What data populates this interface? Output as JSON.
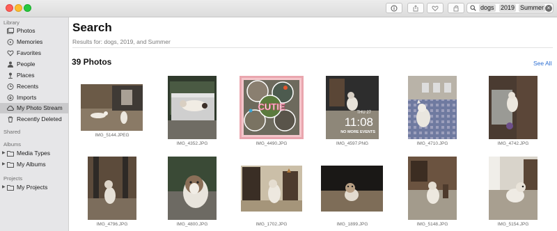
{
  "window": {
    "toolbar_icons": [
      "info-icon",
      "share-icon",
      "heart-icon",
      "rotate-icon",
      "search-icon"
    ],
    "search": {
      "tokens": [
        "dogs",
        "2019",
        "Summer"
      ],
      "clear_icon": "clear-icon"
    }
  },
  "sidebar": {
    "sections": {
      "library": "Library",
      "shared": "Shared",
      "albums": "Albums",
      "projects": "Projects"
    },
    "library_items": [
      {
        "label": "Photos",
        "icon": "photos-icon"
      },
      {
        "label": "Memories",
        "icon": "memories-icon"
      },
      {
        "label": "Favorites",
        "icon": "heart-icon"
      },
      {
        "label": "People",
        "icon": "person-icon"
      },
      {
        "label": "Places",
        "icon": "pin-icon"
      },
      {
        "label": "Recents",
        "icon": "clock-icon"
      },
      {
        "label": "Imports",
        "icon": "import-icon"
      },
      {
        "label": "My Photo Stream",
        "icon": "cloud-icon",
        "selected": true
      },
      {
        "label": "Recently Deleted",
        "icon": "trash-icon"
      }
    ],
    "album_items": [
      {
        "label": "Media Types",
        "icon": "folder-icon"
      },
      {
        "label": "My Albums",
        "icon": "folder-icon"
      }
    ],
    "project_items": [
      {
        "label": "My Projects",
        "icon": "folder-icon"
      }
    ]
  },
  "main": {
    "title": "Search",
    "subtitle": "Results for: dogs, 2019, and Summer",
    "count_label": "39 Photos",
    "see_all": "See All",
    "photos": [
      {
        "name": "IMG_5144.JPEG"
      },
      {
        "name": "IMG_4352.JPG"
      },
      {
        "name": "IMG_4490.JPG",
        "overlay_text": "CUTIE"
      },
      {
        "name": "IMG_4597.PNG",
        "lock_date": "THU 27",
        "lock_time": "11:08",
        "lock_note": "NO MORE EVENTS"
      },
      {
        "name": "IMG_4710.JPG"
      },
      {
        "name": "IMG_4742.JPG"
      },
      {
        "name": "IMG_4796.JPG"
      },
      {
        "name": "IMG_4800.JPG"
      },
      {
        "name": "IMG_1702.JPG"
      },
      {
        "name": "IMG_1899.JPG"
      },
      {
        "name": "IMG_5148.JPG"
      },
      {
        "name": "IMG_5154.JPG"
      }
    ]
  },
  "colors": {
    "accent": "#2d6fd3",
    "sidebar_bg": "#e6e6e8",
    "selected_row": "#c9c9cb"
  }
}
